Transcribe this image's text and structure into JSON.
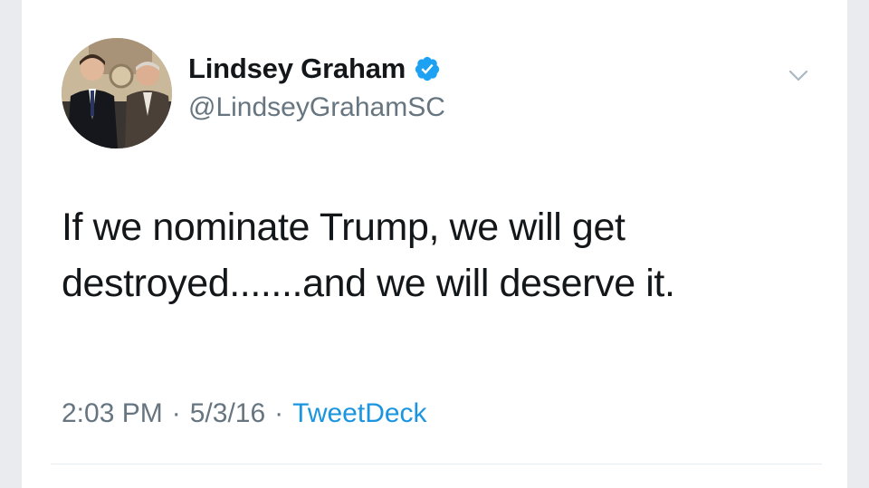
{
  "tweet": {
    "author": {
      "display_name": "Lindsey Graham",
      "handle": "@LindseyGrahamSC",
      "verified": true
    },
    "text_lines": [
      "If we nominate Trump, we will get",
      "destroyed.......and we will deserve it."
    ],
    "time": "2:03 PM",
    "date": "5/3/16",
    "separator": "·",
    "source": "TweetDeck"
  },
  "icons": {
    "verified": "verified-badge-icon",
    "caret": "chevron-down-icon"
  },
  "colors": {
    "text": "#14171a",
    "secondary": "#66757f",
    "link": "#1b95e0",
    "verified": "#1da1f2",
    "background": "#ffffff"
  }
}
